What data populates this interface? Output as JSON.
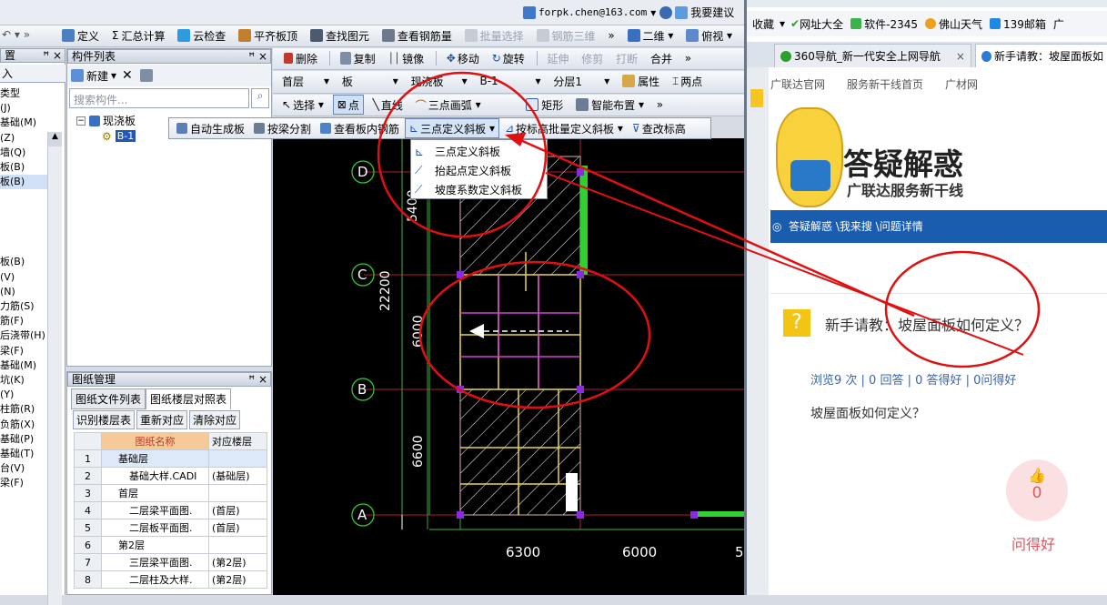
{
  "titlebar": {
    "email": "forpk.chen@163.com",
    "suggest": "我要建议"
  },
  "toolbar1": [
    "定义",
    "汇总计算",
    "云检查",
    "平齐板顶",
    "查找图元",
    "查看钢筋量",
    "批量选择",
    "钢筋三维",
    "二维",
    "俯视"
  ],
  "toolbar2": [
    "删除",
    "复制",
    "镜像",
    "移动",
    "旋转",
    "延伸",
    "修剪",
    "打断",
    "合并"
  ],
  "toolbar3": {
    "floor": "首层",
    "type1": "板",
    "type2": "现浇板",
    "member": "B-1",
    "layer": "分层1",
    "attr": "属性",
    "twopoint": "两点"
  },
  "toolbar4": [
    "选择",
    "点",
    "直线",
    "三点画弧",
    "矩形",
    "智能布置"
  ],
  "ctx_toolbar": [
    "自动生成板",
    "按梁分割",
    "查看板内钢筋",
    "三点定义斜板",
    "按标高批量定义斜板",
    "查改标高"
  ],
  "dropdown": [
    "三点定义斜板",
    "抬起点定义斜板",
    "坡度系数定义斜板"
  ],
  "left_tree": {
    "header": "置",
    "items": [
      "入",
      "类型",
      "(J)",
      "基础(M)",
      "(Z)",
      "墙(Q)",
      "板(B)",
      "板(B)",
      "板(B)",
      "(V)",
      "(N)",
      "力筋(S)",
      "筋(F)",
      "后浇带(H)",
      "梁(F)",
      "基础(M)",
      "坑(K)",
      "(Y)",
      "柱筋(R)",
      "负筋(X)",
      "基础(P)",
      "基础(T)",
      "台(V)",
      "梁(F)"
    ]
  },
  "component_list": {
    "title": "构件列表",
    "new_label": "新建",
    "search_placeholder": "搜索构件...",
    "root": "现浇板",
    "child": "B-1"
  },
  "drawing_mgmt": {
    "title": "图纸管理",
    "tabs": [
      "图纸文件列表",
      "图纸楼层对照表"
    ],
    "buttons": [
      "识别楼层表",
      "重新对应",
      "清除对应"
    ],
    "columns": [
      "图纸名称",
      "对应楼层"
    ],
    "rows": [
      [
        "1",
        "基础层",
        ""
      ],
      [
        "2",
        "基础大样.CADI",
        "(基础层)"
      ],
      [
        "3",
        "首层",
        ""
      ],
      [
        "4",
        "二层梁平面图.",
        "(首层)"
      ],
      [
        "5",
        "二层板平面图.",
        "(首层)"
      ],
      [
        "6",
        "第2层",
        ""
      ],
      [
        "7",
        "三层梁平面图.",
        "(第2层)"
      ],
      [
        "8",
        "二层柱及大样.",
        "(第2层)"
      ]
    ]
  },
  "cad": {
    "axes_v": [
      "D",
      "C",
      "B",
      "A"
    ],
    "dims_left": [
      "5400",
      "22200",
      "6000",
      "6600"
    ],
    "dims_bottom": [
      "6300",
      "6000",
      "5"
    ]
  },
  "browser": {
    "bookmarks": [
      "收藏",
      "网址大全",
      "软件-2345",
      "佛山天气",
      "139邮箱",
      "广"
    ],
    "tabs": [
      "360导航_新一代安全上网导航",
      "新手请教：坡屋面板如"
    ],
    "nav": [
      "广联达官网",
      "服务新干线首页",
      "广材网"
    ],
    "banner_title": "答疑解惑",
    "banner_sub": "广联达服务新干线",
    "breadcrumb": "答疑解惑 \\我来搜 \\问题详情",
    "question_title": "新手请教：坡屋面板如何定义？",
    "stats": "浏览9 次 | 0 回答 | 0 答得好 | 0问得好",
    "question_body": "坡屋面板如何定义？",
    "like_count": "0",
    "like_label": "问得好"
  }
}
